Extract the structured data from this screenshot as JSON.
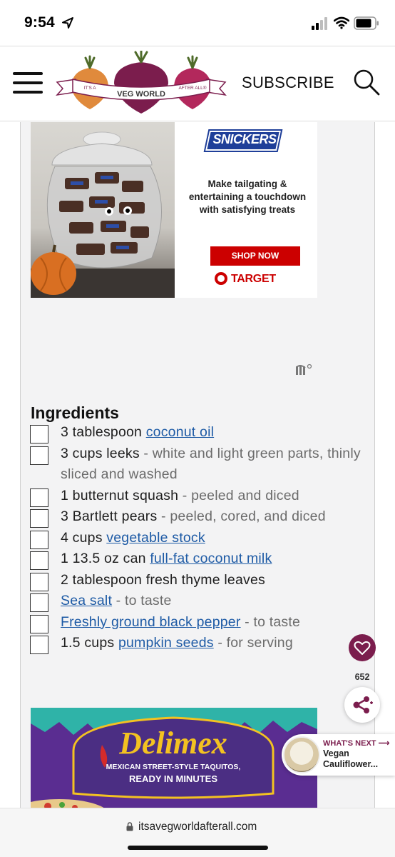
{
  "status_bar": {
    "time": "9:54"
  },
  "header": {
    "logo": {
      "left_text": "IT'S A",
      "center_text": "VEG WORLD",
      "right_text": "AFTER ALL®"
    },
    "subscribe_label": "SUBSCRIBE"
  },
  "ad_top": {
    "brand": "SNICKERS",
    "copy": "Make tailgating & entertaining a touchdown with satisfying treats",
    "cta": "SHOP NOW",
    "retailer": "TARGET"
  },
  "ingredients": {
    "title": "Ingredients",
    "items": [
      {
        "qty": "3 tablespoon ",
        "name": "coconut oil",
        "linked": true,
        "note": ""
      },
      {
        "qty": "3 cups leeks",
        "name": "",
        "linked": false,
        "note": " - white and light green parts, thinly sliced and washed"
      },
      {
        "qty": "1 butternut squash",
        "name": "",
        "linked": false,
        "note": " - peeled and diced"
      },
      {
        "qty": "3 Bartlett pears",
        "name": "",
        "linked": false,
        "note": " - peeled, cored, and diced"
      },
      {
        "qty": "4 cups ",
        "name": "vegetable stock",
        "linked": true,
        "note": ""
      },
      {
        "qty": "1 13.5 oz can ",
        "name": "full-fat coconut milk",
        "linked": true,
        "note": ""
      },
      {
        "qty": "2 tablespoon fresh thyme leaves",
        "name": "",
        "linked": false,
        "note": ""
      },
      {
        "qty": "",
        "name": "Sea salt",
        "linked": true,
        "note": " - to taste"
      },
      {
        "qty": "",
        "name": "Freshly ground black pepper",
        "linked": true,
        "note": " - to taste"
      },
      {
        "qty": "1.5 cups ",
        "name": "pumpkin seeds",
        "linked": true,
        "note": " - for serving"
      }
    ]
  },
  "ad_bottom": {
    "brand": "Delimex",
    "tagline_1": "MEXICAN STREET-STYLE TAQUITOS,",
    "tagline_2": "READY IN MINUTES"
  },
  "floating": {
    "favorites_count": "652",
    "whats_next_label": "WHAT'S NEXT ⟶",
    "whats_next_title_1": "Vegan",
    "whats_next_title_2": "Cauliflower..."
  },
  "browser": {
    "url": "itsavegworldafterall.com"
  },
  "colors": {
    "brand_beet": "#7b1d4d",
    "link_blue": "#1d5aa5",
    "target_red": "#cc0000",
    "snickers_blue": "#1f3f99"
  }
}
